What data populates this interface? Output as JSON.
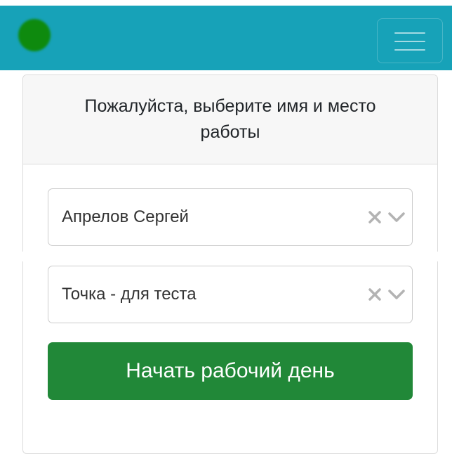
{
  "navbar": {
    "background_color": "#17a2b8",
    "status_indicator": {
      "icon": "status-dot-icon",
      "color": "#0e8a0e"
    },
    "menu_button": {
      "icon": "hamburger-menu-icon"
    }
  },
  "card": {
    "header_text": "Пожалуйста, выберите имя и место работы",
    "employee_select": {
      "value": "Апрелов Сергей",
      "clear_icon": "close-icon",
      "dropdown_icon": "chevron-down-icon"
    },
    "location_select": {
      "value": "Точка - для теста",
      "clear_icon": "close-icon",
      "dropdown_icon": "chevron-down-icon"
    },
    "start_button": {
      "label": "Начать рабочий день",
      "color": "#218838"
    }
  }
}
